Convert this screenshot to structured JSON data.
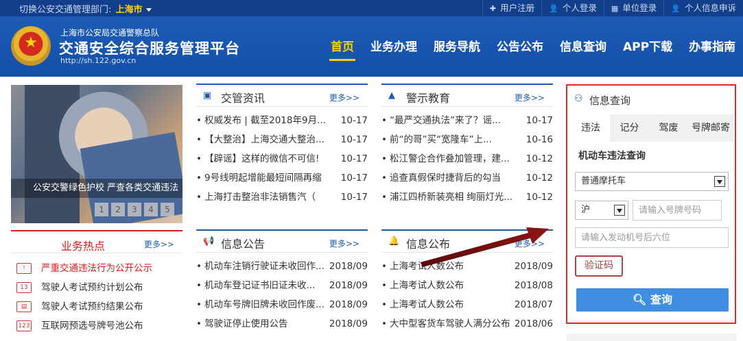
{
  "topbar": {
    "switch_label": "切换公安交通管理部门:",
    "city": "上海市",
    "links": [
      "用户注册",
      "个人登录",
      "单位登录",
      "个人信息申诉"
    ],
    "link_icons": [
      "plus-icon",
      "user-icon",
      "building-icon",
      "user-icon"
    ]
  },
  "header": {
    "dept": "上海市公安局交通警察总队",
    "title": "交通安全综合服务管理平台",
    "url": "http://sh.122.gov.cn"
  },
  "nav": [
    "首页",
    "业务办理",
    "服务导航",
    "公告公布",
    "信息查询",
    "APP下载",
    "办事指南"
  ],
  "banner": {
    "caption": "公安交警绿色护校 严查各类交通违法",
    "pages": [
      "1",
      "2",
      "3",
      "4",
      "5"
    ]
  },
  "hot": {
    "title": "业务热点",
    "more": "更多>>",
    "items": [
      {
        "text": "严重交通违法行为公开公示",
        "icon": "warning-icon"
      },
      {
        "text": "驾驶人考试预约计划公布",
        "icon": "calendar-icon"
      },
      {
        "text": "驾驶人考试预约结果公布",
        "icon": "id-card-icon"
      },
      {
        "text": "互联网预选号牌号池公布",
        "icon": "plate-icon"
      }
    ]
  },
  "news": {
    "title": "交管资讯",
    "more": "更多>>",
    "items": [
      {
        "text": "权威发布 | 截至2018年9月...",
        "date": "10-17"
      },
      {
        "text": "【大整治】上海交通大整治...",
        "date": "10-17"
      },
      {
        "text": "【辟谣】这样的微信不可信!",
        "date": "10-17"
      },
      {
        "text": "9号线明起增能最短间隔再缩",
        "date": "10-17"
      },
      {
        "text": "上海打击整治非法销售汽（",
        "date": "10-17"
      }
    ]
  },
  "warn": {
    "title": "警示教育",
    "more": "更多>>",
    "items": [
      {
        "text": "“最严交通执法”来了？谣...",
        "date": "10-17"
      },
      {
        "text": "前“的哥”买“宽隆车”上...",
        "date": "10-16"
      },
      {
        "text": "松江警企合作叠加管理，建...",
        "date": "10-12"
      },
      {
        "text": "追查真假保时捷背后的勾当",
        "date": "10-12"
      },
      {
        "text": "浦江四桥新装亮相 绚丽灯光...",
        "date": "10-12"
      }
    ]
  },
  "notice": {
    "title": "信息公告",
    "more": "更多>>",
    "items": [
      {
        "text": "机动车注销行驶证未收回作...",
        "date": "2018/09"
      },
      {
        "text": "机动车登记证书旧证未收...",
        "date": "2018/09"
      },
      {
        "text": "机动车号牌旧牌未收回作废...",
        "date": "2018/09"
      },
      {
        "text": "驾驶证停止使用公告",
        "date": "2018/09"
      }
    ]
  },
  "pub": {
    "title": "信息公布",
    "more": "更多>>",
    "items": [
      {
        "text": "上海考试人数公布",
        "date": "2018/09"
      },
      {
        "text": "上海考试人数公布",
        "date": "2018/08"
      },
      {
        "text": "上海考试人数公布",
        "date": "2018/07"
      },
      {
        "text": "大中型客货车驾驶人满分公布",
        "date": "2018/06"
      }
    ]
  },
  "query": {
    "title": "信息查询",
    "tabs": [
      "违法",
      "记分",
      "驾废",
      "号牌邮寄"
    ],
    "active_tab": "违法",
    "subtitle": "机动车违法查询",
    "vehicle_type": "普通摩托车",
    "province": "沪",
    "plate_placeholder": "请输入号牌号码",
    "engine_placeholder": "请输入发动机号后六位",
    "captcha_label": "验证码",
    "submit_label": "查询"
  },
  "colors": {
    "nav_bg": "#1450a8",
    "active_nav": "#ffd200",
    "hot_red": "#e01a1a",
    "query_border": "#e02828",
    "submit_bg": "#3f8ee0",
    "annotation_arrow": "#7a0e0e"
  }
}
